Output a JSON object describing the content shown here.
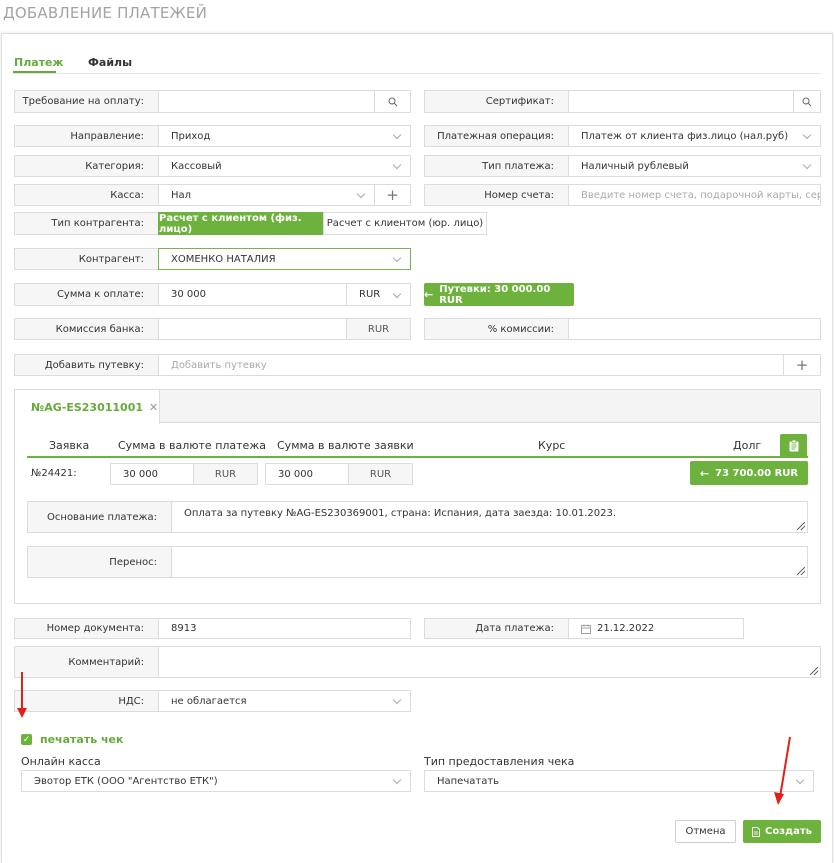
{
  "page_title": "ДОБАВЛЕНИЕ ПЛАТЕЖЕЙ",
  "tabs": [
    {
      "label": "Платеж",
      "active": true
    },
    {
      "label": "Файлы",
      "active": false
    }
  ],
  "form": {
    "payment_request_label": "Требование на оплату:",
    "certificate_label": "Сертификат:",
    "direction_label": "Направление:",
    "direction_value": "Приход",
    "payment_operation_label": "Платежная операция:",
    "payment_operation_value": "Платеж от клиента физ.лицо (нал.руб)",
    "category_label": "Категория:",
    "category_value": "Кассовый",
    "payment_type_label": "Тип платежа:",
    "payment_type_value": "Наличный рублевый",
    "cashbox_label": "Касса:",
    "cashbox_value": "Нал",
    "account_number_label": "Номер счета:",
    "account_number_placeholder": "Введите номер счета, подарочной карты, сертификата",
    "counterparty_type_label": "Тип контрагента:",
    "counterparty_type_options": [
      "Расчет с клиентом (физ. лицо)",
      "Расчет с клиентом (юр. лицо)"
    ],
    "counterparty_label": "Контрагент:",
    "counterparty_value": "ХОМЕНКО НАТАЛИЯ",
    "amount_label": "Сумма к оплате:",
    "amount_value": "30 000",
    "amount_currency": "RUR",
    "voucher_button": "Путевки: 30 000.00 RUR",
    "bank_fee_label": "Комиссия банка:",
    "bank_fee_currency": "RUR",
    "fee_percent_label": "% комиссии:",
    "add_voucher_label": "Добавить путевку:",
    "add_voucher_placeholder": "Добавить путевку"
  },
  "voucher": {
    "tab_label": "№AG-ES23011001",
    "columns": [
      "Заявка",
      "Сумма в валюте платежа",
      "Сумма в валюте заявки",
      "Курс",
      "Долг"
    ],
    "row": {
      "order": "№24421:",
      "amount_payment": "30 000",
      "currency_payment": "RUR",
      "amount_order": "30 000",
      "currency_order": "RUR",
      "debt_button": "73 700.00 RUR"
    },
    "basis_label": "Основание платежа:",
    "basis_value": "Оплата за путевку №AG-ES230369001, страна: Испания, дата заезда: 10.01.2023.",
    "transfer_label": "Перенос:"
  },
  "bottom": {
    "doc_number_label": "Номер документа:",
    "doc_number_value": "8913",
    "payment_date_label": "Дата платежа:",
    "payment_date_value": "21.12.2022",
    "comment_label": "Комментарий:",
    "vat_label": "НДС:",
    "vat_value": "не облагается",
    "print_check_label": "печатать чек",
    "online_cashbox_label": "Онлайн касса",
    "online_cashbox_value": "Эвотор ЕТК (ООО \"Агентство ЕТК\")",
    "check_type_label": "Тип предоставления чека",
    "check_type_value": "Напечатать",
    "cancel_button": "Отмена",
    "create_button": "Создать"
  },
  "colors": {
    "accent": "#6db23d",
    "annotation": "#e0201b"
  }
}
